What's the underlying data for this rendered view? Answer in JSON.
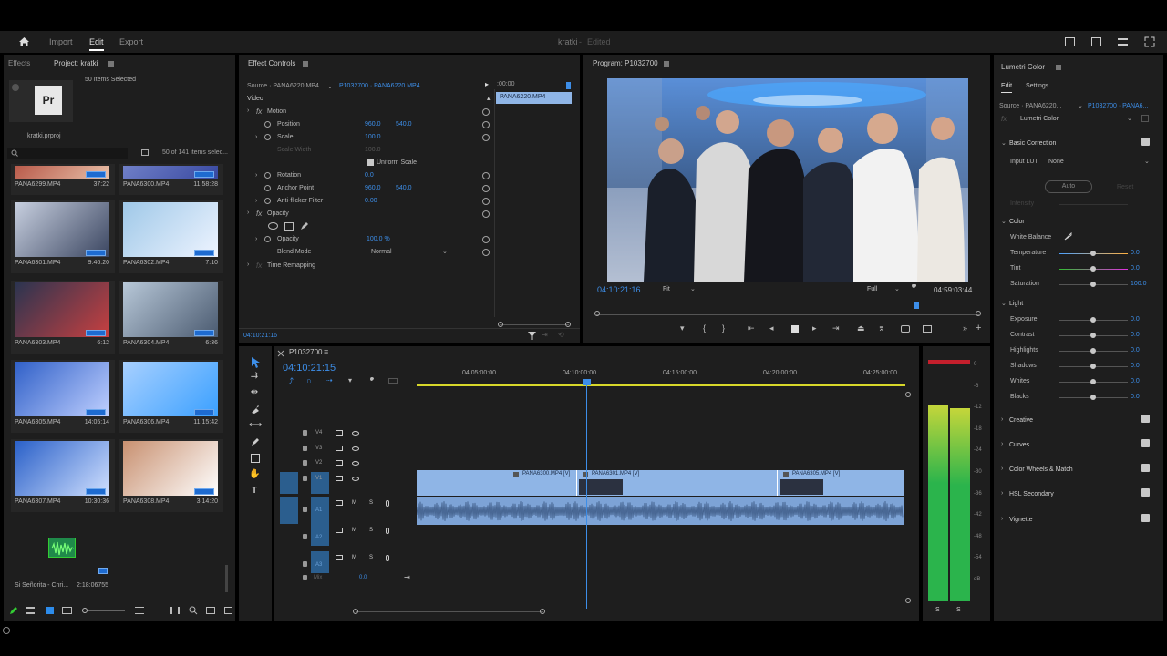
{
  "app": {
    "title": "kratki",
    "edited": "Edited"
  },
  "nav": {
    "import": "Import",
    "edit": "Edit",
    "export": "Export"
  },
  "project": {
    "tab_effects": "Effects",
    "tab_project": "Project: kratki",
    "selected": "50 Items Selected",
    "file": "kratki.prproj",
    "count": "50 of 141 items selec...",
    "clips": [
      {
        "name": "PANA6299.MP4",
        "dur": "37:22"
      },
      {
        "name": "PANA6300.MP4",
        "dur": "11:58:28"
      },
      {
        "name": "PANA6301.MP4",
        "dur": "9:46:20"
      },
      {
        "name": "PANA6302.MP4",
        "dur": "7:10"
      },
      {
        "name": "PANA6303.MP4",
        "dur": "6:12"
      },
      {
        "name": "PANA6304.MP4",
        "dur": "6:36"
      },
      {
        "name": "PANA6305.MP4",
        "dur": "14:05:14"
      },
      {
        "name": "PANA6306.MP4",
        "dur": "11:15:42"
      },
      {
        "name": "PANA6307.MP4",
        "dur": "10:30:36"
      },
      {
        "name": "PANA6308.MP4",
        "dur": "3:14:20"
      }
    ],
    "audio_clip": {
      "name": "Si Señorita - Chri...",
      "dur": "2:18:06755"
    }
  },
  "effect_controls": {
    "tab": "Effect Controls",
    "source": "Source · PANA6220.MP4",
    "sequence": "P1032700 · PANA6220.MP4",
    "timecode_head": ":00:00",
    "clip_label": "PANA6220.MP4",
    "video": "Video",
    "motion": "Motion",
    "position": "Position",
    "position_x": "960.0",
    "position_y": "540.0",
    "scale": "Scale",
    "scale_val": "100.0",
    "scale_width": "Scale Width",
    "scale_width_val": "100.0",
    "uniform_scale": "Uniform Scale",
    "rotation": "Rotation",
    "rotation_val": "0.0",
    "anchor": "Anchor Point",
    "anchor_x": "960.0",
    "anchor_y": "540.0",
    "antiflicker": "Anti-flicker Filter",
    "antiflicker_val": "0.00",
    "opacity_group": "Opacity",
    "opacity": "Opacity",
    "opacity_val": "100.0 %",
    "blend": "Blend Mode",
    "blend_val": "Normal",
    "time_remap": "Time Remapping",
    "timecode": "04:10:21:16"
  },
  "program": {
    "tab": "Program: P1032700",
    "timecode": "04:10:21:16",
    "fit": "Fit",
    "quality": "Full",
    "duration": "04:59:03:44"
  },
  "timeline": {
    "tab": "P1032700",
    "timecode": "04:10:21:15",
    "ruler": [
      "04:05:00:00",
      "04:10:00:00",
      "04:15:00:00",
      "04:20:00:00",
      "04:25:00:00"
    ],
    "tracks_video": [
      "V4",
      "V3",
      "V2",
      "V1"
    ],
    "tracks_audio": [
      "A1",
      "A2",
      "A3"
    ],
    "mix": "Mix",
    "mix_val": "0.0",
    "clips": [
      "PANA6300.MP4 [V]",
      "PANA6301.MP4 [V]",
      "PANA6305.MP4 [V]"
    ]
  },
  "meter": {
    "labels": [
      "0",
      "-6",
      "-12",
      "-18",
      "-24",
      "-30",
      "-36",
      "-42",
      "-48",
      "-54",
      "dB"
    ],
    "solo": [
      "S",
      "S"
    ]
  },
  "lumetri": {
    "tab": "Lumetri Color",
    "tab_edit": "Edit",
    "tab_settings": "Settings",
    "source": "Source · PANA6220...",
    "sequence": "P1032700 · PANA6...",
    "effect": "Lumetri Color",
    "basic": "Basic Correction",
    "input_lut": "Input LUT",
    "input_lut_val": "None",
    "auto": "Auto",
    "reset": "Reset",
    "intensity": "Intensity",
    "color": "Color",
    "white_balance": "White Balance",
    "temperature": "Temperature",
    "temperature_val": "0.0",
    "tint": "Tint",
    "tint_val": "0.0",
    "saturation": "Saturation",
    "saturation_val": "100.0",
    "light": "Light",
    "exposure": "Exposure",
    "exposure_val": "0.0",
    "contrast": "Contrast",
    "contrast_val": "0.0",
    "highlights": "Highlights",
    "highlights_val": "0.0",
    "shadows": "Shadows",
    "shadows_val": "0.0",
    "whites": "Whites",
    "whites_val": "0.0",
    "blacks": "Blacks",
    "blacks_val": "0.0",
    "creative": "Creative",
    "curves": "Curves",
    "wheels": "Color Wheels & Match",
    "hsl": "HSL Secondary",
    "vignette": "Vignette"
  },
  "colors": {
    "accent": "#3d8ee8",
    "clip": "#8fb5e6",
    "panel": "#1e1e1e"
  }
}
